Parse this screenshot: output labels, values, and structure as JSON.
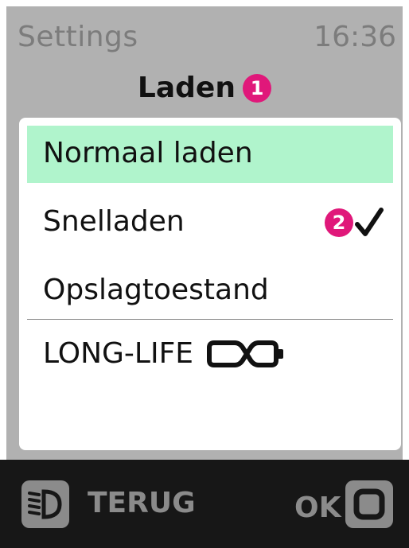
{
  "header": {
    "app_title": "Settings",
    "time": "16:36"
  },
  "page": {
    "title": "Laden",
    "annotation_1": "1"
  },
  "menu": {
    "items": [
      {
        "label": "Normaal laden",
        "highlighted": true
      },
      {
        "label": "Snelladen",
        "checked": true,
        "annotation": "2"
      },
      {
        "label": "Opslagtoestand"
      },
      {
        "label": "LONG-LIFE",
        "icon": "long-life-icon"
      }
    ]
  },
  "footer": {
    "back_label": "TERUG",
    "back_icon": "headlight-icon",
    "ok_label": "OK",
    "ok_icon": "ok-square-icon"
  },
  "colors": {
    "highlight": "#b0f4cc",
    "annotation": "#e0187a",
    "screen_bg": "#b1b1b1",
    "bar_bg": "#171717"
  }
}
